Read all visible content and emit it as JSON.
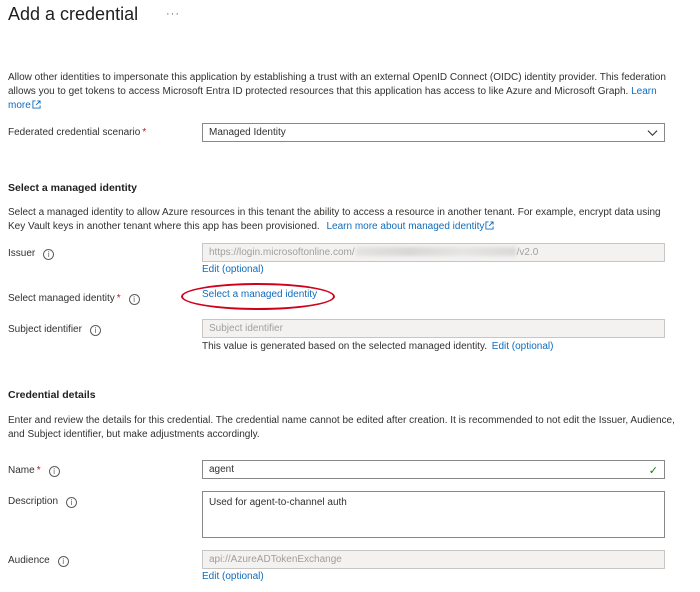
{
  "header": {
    "title": "Add a credential",
    "more_label": "···"
  },
  "intro": {
    "text": "Allow other identities to impersonate this application by establishing a trust with an external OpenID Connect (OIDC) identity provider. This federation allows you to get tokens to access Microsoft Entra ID protected resources that this application has access to like Azure and Microsoft Graph.",
    "learn_more": "Learn more"
  },
  "scenario": {
    "label": "Federated credential scenario",
    "required_mark": "*",
    "value": "Managed Identity"
  },
  "managed_identity_section": {
    "title": "Select a managed identity",
    "description": "Select a managed identity to allow Azure resources in this tenant the ability to access a resource in another tenant. For example, encrypt data using Key Vault keys in another tenant where this app has been provisioned.",
    "learn_more": "Learn more about managed identity",
    "issuer": {
      "label": "Issuer",
      "value_prefix": "https://login.microsoftonline.com/",
      "value_suffix": "/v2.0",
      "edit_link": "Edit (optional)"
    },
    "select_identity": {
      "label": "Select managed identity",
      "required_mark": "*",
      "link": "Select a managed identity"
    },
    "subject": {
      "label": "Subject identifier",
      "placeholder": "Subject identifier",
      "helper": "This value is generated based on the selected managed identity.",
      "edit_link": "Edit (optional)"
    }
  },
  "credential_details": {
    "title": "Credential details",
    "description": "Enter and review the details for this credential. The credential name cannot be edited after creation. It is recommended to not edit the Issuer, Audience, and Subject identifier, but make adjustments accordingly.",
    "name": {
      "label": "Name",
      "required_mark": "*",
      "value": "agent"
    },
    "description_field": {
      "label": "Description",
      "value": "Used for agent-to-channel auth"
    },
    "audience": {
      "label": "Audience",
      "value": "api://AzureADTokenExchange",
      "edit_link": "Edit (optional)"
    }
  },
  "icons": {
    "info": "info-icon",
    "external": "external-link-icon",
    "chevron": "chevron-down-icon",
    "check": "checkmark-icon"
  },
  "colors": {
    "link": "#0f6cbd",
    "required": "#a4262c",
    "highlight": "#d0021b",
    "valid": "#107c10"
  }
}
